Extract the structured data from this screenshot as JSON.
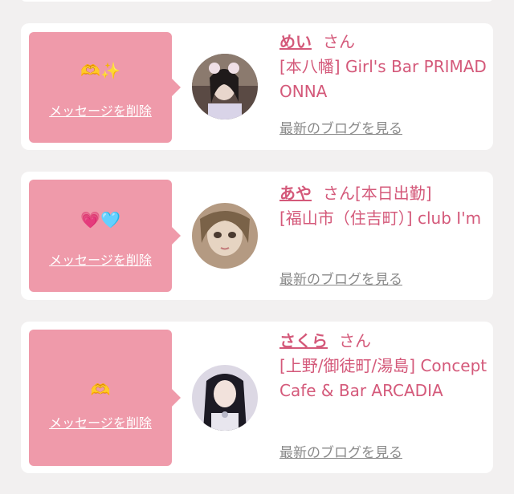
{
  "cards": [
    {
      "emoji": "🫶✨",
      "delete_label": "メッセージを削除",
      "name": "めい",
      "honorific": "さん",
      "status": "",
      "shop": "[本八幡] Girl's Bar PRIMADONNA",
      "blog_link": "最新のブログを見る"
    },
    {
      "emoji": "💗🩵",
      "delete_label": "メッセージを削除",
      "name": "あや",
      "honorific": "さん",
      "status": "[本日出勤]",
      "shop": "[福山市（住吉町）] club I'm",
      "blog_link": "最新のブログを見る"
    },
    {
      "emoji": "🫶",
      "delete_label": "メッセージを削除",
      "name": "さくら",
      "honorific": "さん",
      "status": "",
      "shop": "[上野/御徒町/湯島] Concept Cafe & Bar ARCADIA",
      "blog_link": "最新のブログを見る"
    }
  ],
  "colors": {
    "background": "#f2f0f0",
    "card": "#ffffff",
    "bubble": "#ef9aaa",
    "accent_text": "#d4597a",
    "link_gray": "#8a8a8a"
  }
}
